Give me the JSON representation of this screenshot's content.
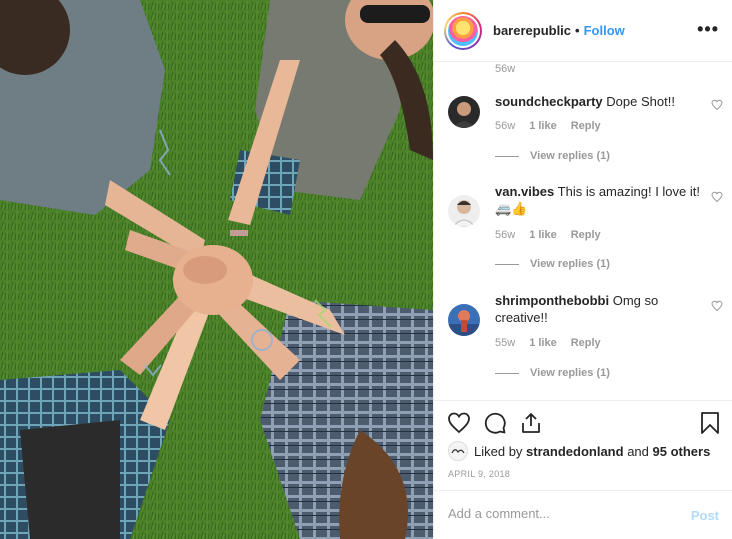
{
  "post": {
    "username": "barerepublic",
    "separator": "•",
    "follow_label": "Follow",
    "more_label": "•••"
  },
  "comments": {
    "top_time": "56w",
    "items": [
      {
        "user": "soundcheckparty",
        "text": "Dope Shot!!",
        "time": "56w",
        "likes": "1 like",
        "reply": "Reply",
        "view_replies": "View replies (1)"
      },
      {
        "user": "van.vibes",
        "text": "This is amazing! I love it!🚐👍",
        "time": "56w",
        "likes": "1 like",
        "reply": "Reply",
        "view_replies": "View replies (1)"
      },
      {
        "user": "shrimponthebobbi",
        "text": "Omg so creative!!",
        "time": "55w",
        "likes": "1 like",
        "reply": "Reply",
        "view_replies": "View replies (1)"
      }
    ]
  },
  "actions": {
    "icons": [
      "heart-icon",
      "comment-icon",
      "share-icon",
      "bookmark-icon"
    ]
  },
  "likes": {
    "prefix": "Liked by",
    "user": "strandedonland",
    "and": "and",
    "others": "95 others"
  },
  "date": "APRIL 9, 2018",
  "add_comment": {
    "placeholder": "Add a comment...",
    "post_label": "Post"
  },
  "colors": {
    "accent": "#3897f0",
    "post_disabled": "#b3dbff",
    "muted": "#999999"
  }
}
